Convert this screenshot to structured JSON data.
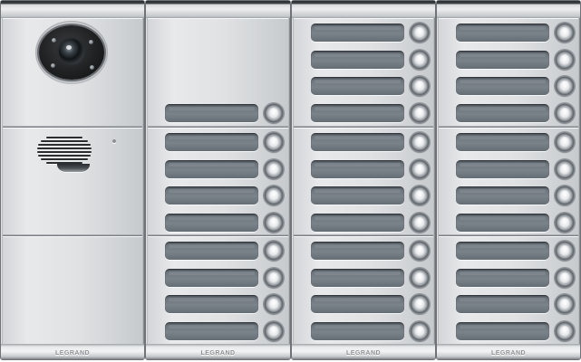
{
  "panel": {
    "brand_text": "LEGRAND",
    "columns": [
      {
        "brand": "LEGRAND",
        "top_buttons": 0,
        "mid_buttons": 0,
        "bot_buttons": 0
      },
      {
        "brand": "LEGRAND",
        "top_buttons": 1,
        "mid_buttons": 4,
        "bot_buttons": 4
      },
      {
        "brand": "LEGRAND",
        "top_buttons": 4,
        "mid_buttons": 4,
        "bot_buttons": 4
      },
      {
        "brand": "LEGRAND",
        "top_buttons": 4,
        "mid_buttons": 4,
        "bot_buttons": 4
      }
    ],
    "total_call_buttons": 33,
    "colors": {
      "housing": "#dfe1e3",
      "name_tag": "#6d757d",
      "button_ring": "#5d6369",
      "camera_face": "#1f2123"
    },
    "icons": [
      "camera-icon",
      "speaker-grille-icon",
      "microphone-icon",
      "push-button-icon"
    ]
  }
}
